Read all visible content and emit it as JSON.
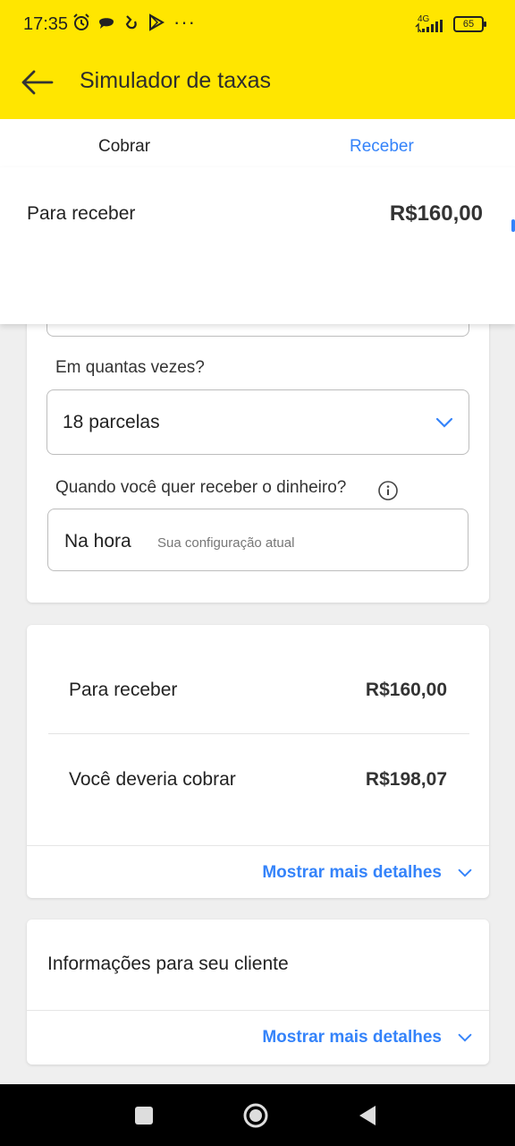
{
  "status_bar": {
    "time": "17:35",
    "network": "4G",
    "battery": "65",
    "overflow": "···"
  },
  "app_bar": {
    "title": "Simulador de taxas",
    "back_icon": "arrow-left-icon",
    "background": "#ffe600"
  },
  "tabs": [
    {
      "label": "Cobrar",
      "active": false
    },
    {
      "label": "Receber",
      "active": true
    }
  ],
  "sticky_summary": {
    "label": "Para receber",
    "value": "R$160,00"
  },
  "form": {
    "installments_question": "Em quantas vezes?",
    "installments_value": "18 parcelas",
    "receive_question": "Quando você quer receber o dinheiro?",
    "receive_value": "Na hora",
    "receive_hint": "Sua configuração atual"
  },
  "summary": {
    "rows": [
      {
        "label": "Para receber",
        "value": "R$160,00"
      },
      {
        "label": "Você deveria cobrar",
        "value": "R$198,07"
      }
    ],
    "more_details": "Mostrar mais detalhes"
  },
  "client_info": {
    "title": "Informações para seu cliente",
    "more_details": "Mostrar mais detalhes"
  },
  "colors": {
    "accent": "#3483fa",
    "brand": "#ffe600"
  }
}
